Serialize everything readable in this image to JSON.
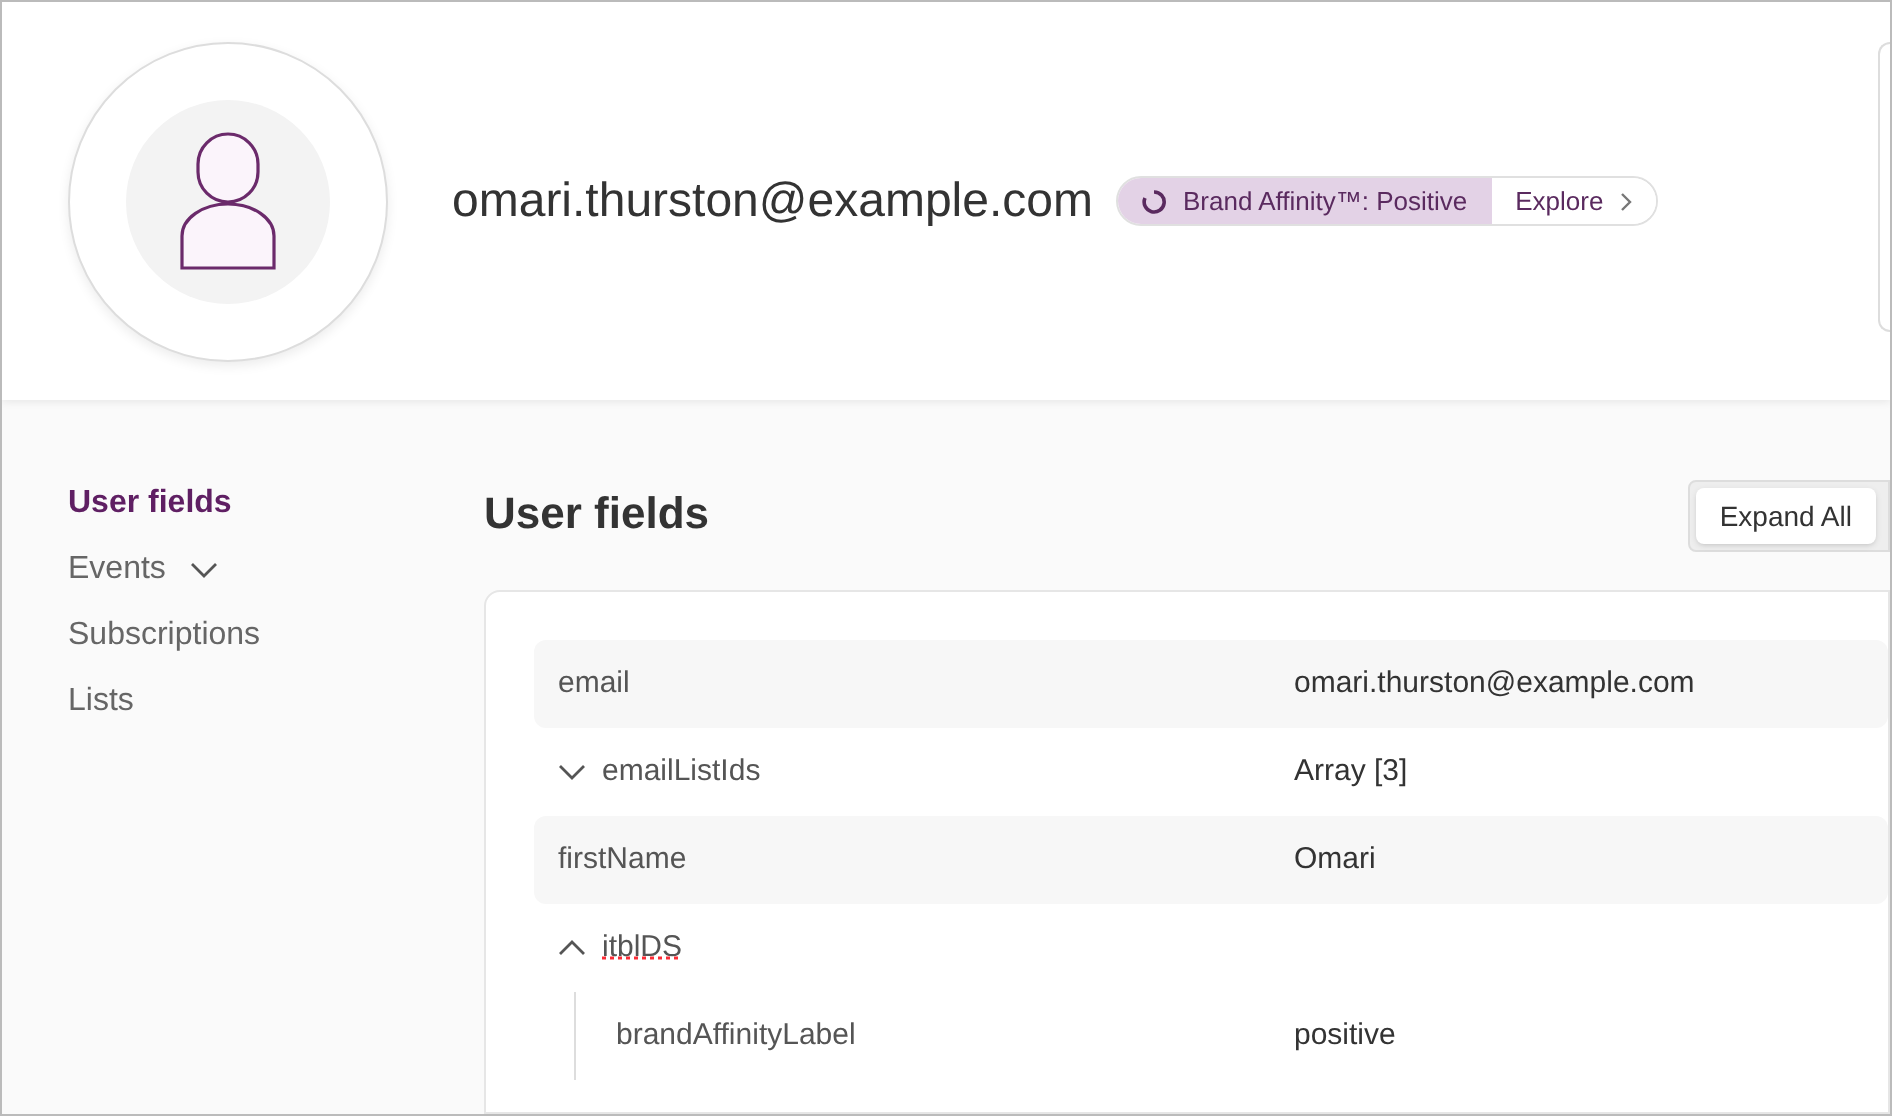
{
  "header": {
    "email": "omari.thurston@example.com",
    "badge": {
      "label": "Brand Affinity™: Positive",
      "action": "Explore"
    }
  },
  "sidebar": {
    "items": [
      {
        "label": "User fields",
        "selected": true,
        "kind": "link"
      },
      {
        "label": "Events",
        "selected": false,
        "kind": "menu"
      },
      {
        "label": "Subscriptions",
        "selected": false,
        "kind": "link"
      },
      {
        "label": "Lists",
        "selected": false,
        "kind": "link"
      }
    ]
  },
  "content": {
    "title": "User fields",
    "expand_button": "Expand All",
    "rows": [
      {
        "kind": "field",
        "key": "email",
        "value": "omari.thurston@example.com"
      },
      {
        "kind": "group",
        "key": "emailListIds",
        "value": "Array [3]",
        "expanded": false
      },
      {
        "kind": "field",
        "key": "firstName",
        "value": "Omari"
      },
      {
        "kind": "group",
        "key": "itblDS",
        "expanded": true,
        "children": [
          {
            "key": "brandAffinityLabel",
            "value": "positive"
          }
        ]
      }
    ]
  }
}
